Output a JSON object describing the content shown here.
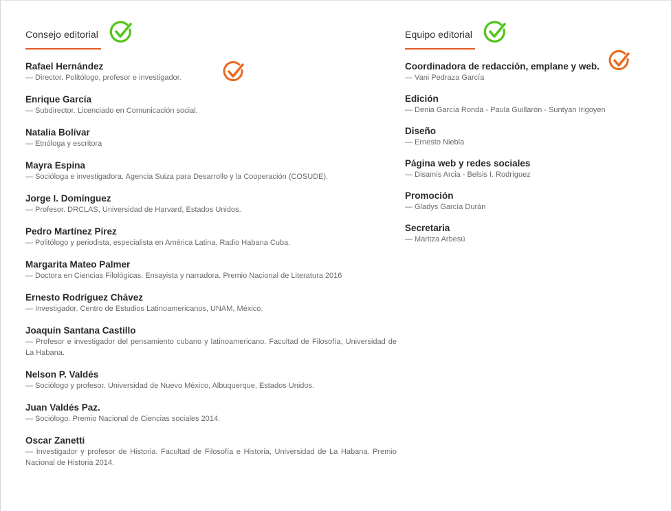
{
  "left_section": {
    "title": "Consejo editorial",
    "members": [
      {
        "name": "Rafael Hernández",
        "desc": "— Director. Politólogo, profesor e investigador."
      },
      {
        "name": "Enrique García",
        "desc": "— Subdirector. Licenciado en Comunicación social."
      },
      {
        "name": "Natalia Bolívar",
        "desc": "— Etnóloga y escritora"
      },
      {
        "name": "Mayra Espina",
        "desc": "— Socióloga e investigadora. Agencia Suiza para Desarrollo y la Cooperación (COSUDE)."
      },
      {
        "name": "Jorge I. Domínguez",
        "desc": "— Profesor. DRCLAS, Universidad de Harvard, Estados Unidos."
      },
      {
        "name": "Pedro Martínez Pírez",
        "desc": "— Politólogo y periodista, especialista en América Latina, Radio Habana Cuba."
      },
      {
        "name": "Margarita Mateo Palmer",
        "desc": "— Doctora en Ciencias Filológicas. Ensayista y narradora. Premio Nacional de Literatura 2016"
      },
      {
        "name": "Ernesto Rodríguez Chávez",
        "desc": "— Investigador. Centro de Estudios Latinoamericanos, UNAM, México."
      },
      {
        "name": "Joaquín Santana Castillo",
        "desc": "— Profesor e investigador del pensamiento cubano y latinoamericano. Facultad de Filosofía, Universidad de La Habana."
      },
      {
        "name": "Nelson P. Valdés",
        "desc": "— Sociólogo y profesor. Universidad de Nuevo México, Albuquerque, Estados Unidos."
      },
      {
        "name": "Juan Valdés Paz.",
        "desc": "— Sociólogo. Premio Nacional de Ciencias sociales 2014."
      },
      {
        "name": "Oscar Zanetti",
        "desc": "— Investigador y profesor de Historia. Facultad de Filosofía e Historia, Universidad de La Habana. Premio Nacional de Historia 2014."
      }
    ]
  },
  "right_section": {
    "title": "Equipo editorial",
    "members": [
      {
        "name": "Coordinadora de redacción, emplane y web.",
        "desc": "— Vani Pedraza García"
      },
      {
        "name": "Edición",
        "desc": "— Denia García Ronda - Paula Guillarón - Suntyan Irigoyen"
      },
      {
        "name": "Diseño",
        "desc": "— Ernesto Niebla"
      },
      {
        "name": "Página web y redes sociales",
        "desc": "— Disamis Arcia - Belsis I. Rodríguez"
      },
      {
        "name": "Promoción",
        "desc": "— Gladys García Durán"
      },
      {
        "name": "Secretaria",
        "desc": "— Maritza Arbesú"
      }
    ]
  },
  "colors": {
    "accent_underline": "#e05a1f",
    "check_green": "#52c41a",
    "check_orange": "#e8681f"
  },
  "icons": {
    "section_check": "check-circle-green-icon",
    "annotation_check": "check-circle-orange-icon"
  }
}
